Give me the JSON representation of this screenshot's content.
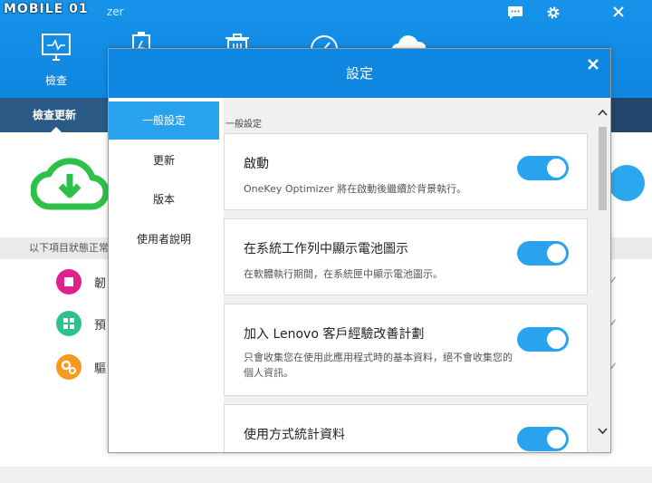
{
  "watermark": "MOBILE 01",
  "app_title_fragment": "zer",
  "colors": {
    "header_blue": "#1693ea",
    "accent": "#2aa3ef",
    "dark_bar": "#24466c"
  },
  "background_app": {
    "nav": [
      {
        "name": "check",
        "label": "檢查",
        "icon": "monitor-icon"
      },
      {
        "name": "battery",
        "label": "",
        "icon": "battery-icon"
      },
      {
        "name": "trash",
        "label": "",
        "icon": "trash-icon"
      },
      {
        "name": "gauge",
        "label": "",
        "icon": "gauge-icon"
      },
      {
        "name": "cloud",
        "label": "",
        "icon": "cloud-icon"
      }
    ],
    "active_tab": "檢查更新",
    "status_text": "以下項目狀態正常",
    "items": [
      {
        "label": "韌",
        "icon": "chip-icon",
        "icon_color": "#e0208c"
      },
      {
        "label": "預",
        "icon": "grid-icon",
        "icon_color": "#2ec18b"
      },
      {
        "label": "驅",
        "icon": "gears-icon",
        "icon_color": "#f59a1f"
      }
    ],
    "controls": {
      "chat": "chat-icon",
      "settings": "gear-icon",
      "close": "close-icon"
    }
  },
  "dialog": {
    "title": "設定",
    "sidebar": [
      {
        "label": "一般設定",
        "active": true
      },
      {
        "label": "更新",
        "active": false
      },
      {
        "label": "版本",
        "active": false
      },
      {
        "label": "使用者說明",
        "active": false
      }
    ],
    "section_header": "一般設定",
    "settings": [
      {
        "title": "啟動",
        "description": "OneKey Optimizer 將在啟動後繼續於背景執行。",
        "enabled": true
      },
      {
        "title": "在系統工作列中顯示電池圖示",
        "description": "在軟體執行期間，在系統匣中顯示電池圖示。",
        "enabled": true
      },
      {
        "title": "加入 Lenovo 客戶經驗改善計劃",
        "description": "只會收集您在使用此應用程式時的基本資料，絕不會收集您的個人資訊。",
        "enabled": true
      },
      {
        "title": "使用方式統計資料",
        "description": "",
        "enabled": true
      }
    ]
  }
}
